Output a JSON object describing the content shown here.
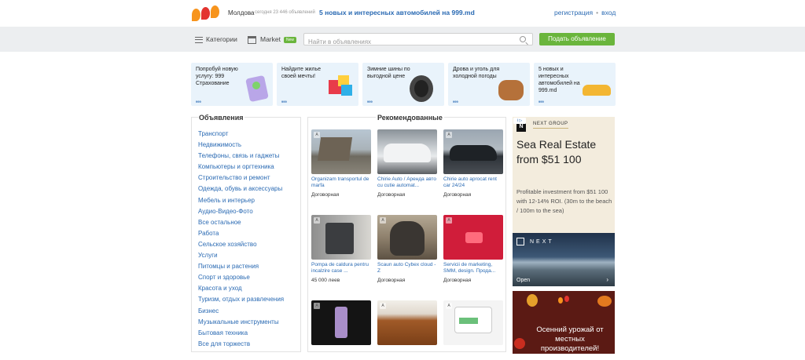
{
  "header": {
    "region": "Молдова",
    "today": "сегодня 23 446 объявлений",
    "promo_link": "5 новых и интересных автомобилей на 999.md",
    "register": "регистрация",
    "separator": "•",
    "login": "вход"
  },
  "colors": {
    "accent": "#6ab53c",
    "link": "#2a6ab3",
    "logo_orange": "#f7941d",
    "logo_red": "#e3342f"
  },
  "toolbar": {
    "categories": "Категории",
    "market": "Market",
    "market_badge": "New",
    "search_placeholder": "Найти в объявлениях",
    "post_button": "Подать объявление"
  },
  "banners": [
    {
      "title": "Попробуй новую услугу: 999 Страхование",
      "brand": "999"
    },
    {
      "title": "Найдите жилье своей мечты!",
      "brand": "999"
    },
    {
      "title": "Зимние шины по выгодной цене",
      "brand": "999"
    },
    {
      "title": "Дрова и уголь для холодной погоды",
      "brand": "999"
    },
    {
      "title": "5 новых и интересных автомобилей на 999.md",
      "brand": "999"
    }
  ],
  "categories": {
    "title": "Объявления",
    "items": [
      "Транспорт",
      "Недвижимость",
      "Телефоны, связь и гаджеты",
      "Компьютеры и оргтехника",
      "Строительство и ремонт",
      "Одежда, обувь и аксессуары",
      "Мебель и интерьер",
      "Аудио-Видео-Фото",
      "Все остальное",
      "Работа",
      "Сельское хозяйство",
      "Услуги",
      "Питомцы и растения",
      "Спорт и здоровье",
      "Красота и уход",
      "Туризм, отдых и развлечения",
      "Бизнес",
      "Музыкальные инструменты",
      "Бытовая техника",
      "Все для торжеств"
    ]
  },
  "recommended": {
    "title": "Рекомендованные",
    "items": [
      {
        "name": "Organizam transportul de marfa",
        "price": "Договорная",
        "badge": "A"
      },
      {
        "name": "Chirie Auto / Аренда авто cu cutie automat...",
        "price": "Договорная",
        "badge": ""
      },
      {
        "name": "Chirie auto aprocat rent car 24/24",
        "price": "Договорная",
        "badge": "A"
      },
      {
        "name": "Pompa de caldura pentru incalzire case ...",
        "price": "45 000 леев",
        "badge": "A"
      },
      {
        "name": "Scaun auto Cybex cloud -Z",
        "price": "Договорная",
        "badge": "A"
      },
      {
        "name": "Servicii de marketing, SMM, design. Прода...",
        "price": "Договорная",
        "badge": "A"
      },
      {
        "name": "",
        "price": "",
        "badge": "A"
      },
      {
        "name": "",
        "price": "",
        "badge": "A"
      },
      {
        "name": "",
        "price": "",
        "badge": "A"
      }
    ]
  },
  "ad_next": {
    "ad_label": "i ▷",
    "logo_letter": "N",
    "group": "NEXT GROUP",
    "headline": "Sea Real Estate from $51 100",
    "body": "Profitable investment from $51 100 with 12-14% ROI. (30m to the beach / 100m to the sea)",
    "image_brand": "NEXT",
    "open": "Open",
    "arrow": "›"
  },
  "ad_harvest": {
    "text": "Осенний урожай от местных производителей!"
  }
}
